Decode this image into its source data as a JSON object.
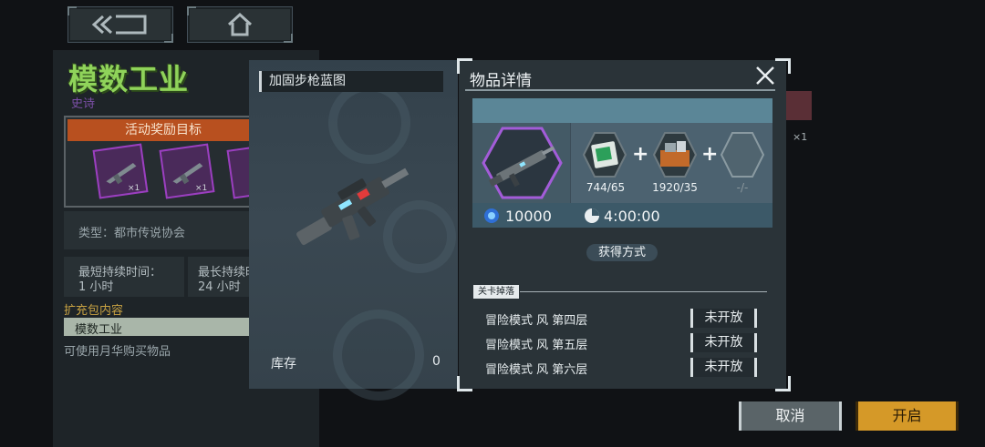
{
  "pack": {
    "title": "模数工业",
    "rarity": "史诗",
    "reward_header": "活动奖励目标",
    "reward_counts": [
      "×1",
      "×1"
    ],
    "type_label": "类型：都市传说协会",
    "min_time_label": "最短持续时间：",
    "min_time_value": "1 小时",
    "max_time_label": "最长持续时间",
    "max_time_value": "24 小时",
    "expansion_label": "扩充包内容",
    "expansion_item": "模数工业",
    "currency_note": "可使用月华购买物品",
    "bg_count": "×1"
  },
  "blueprint": {
    "title": "加固步枪蓝图",
    "stock_label": "库存",
    "stock_value": "0"
  },
  "details": {
    "title": "物品详情",
    "ingredients": [
      {
        "icon": "circuit-board-icon",
        "qty": "744/65"
      },
      {
        "icon": "supply-crate-icon",
        "qty": "1920/35"
      },
      {
        "icon": "empty-slot-icon",
        "qty": "-/-"
      }
    ],
    "plus": "+",
    "cost": "10000",
    "time": "4:00:00",
    "obtain_button": "获得方式",
    "drop_section": "关卡掉落",
    "drops": [
      {
        "label": "冒险模式 风 第四层",
        "status": "未开放"
      },
      {
        "label": "冒险模式 风 第五层",
        "status": "未开放"
      },
      {
        "label": "冒险模式 风 第六层",
        "status": "未开放"
      }
    ]
  },
  "buttons": {
    "cancel": "取消",
    "open": "开启"
  },
  "colors": {
    "accent_green": "#8fd35a",
    "epic_purple": "#9b3fc0",
    "reward_orange": "#b8501f",
    "open_button": "#d59928"
  }
}
